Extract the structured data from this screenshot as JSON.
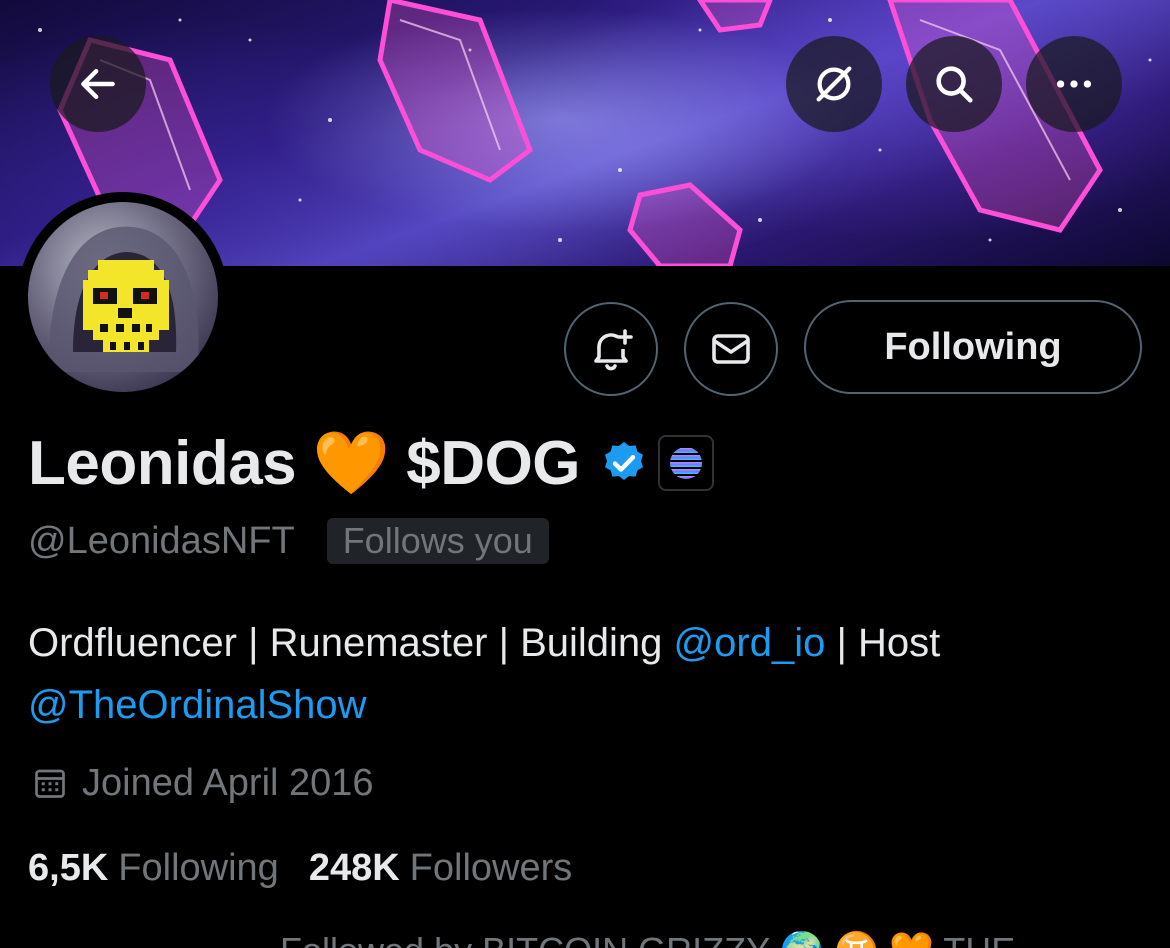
{
  "header": {
    "back_icon": "arrow-left-icon",
    "grok_icon": "grok-icon",
    "search_icon": "search-icon",
    "more_icon": "more-horizontal-icon"
  },
  "actions": {
    "notify_icon": "bell-plus-icon",
    "message_icon": "envelope-icon",
    "following_label": "Following"
  },
  "profile": {
    "display_name": "Leonidas 🧡 $DOG",
    "verified_icon": "verified-badge-icon",
    "affiliation_icon": "affiliation-badge-icon",
    "handle": "@LeonidasNFT",
    "follows_you": "Follows you",
    "bio": {
      "part1": "Ordfluencer | Runemaster | Building ",
      "mention1": "@ord_io",
      "part2": " | Host ",
      "mention2": "@TheOrdinalShow"
    },
    "joined": "Joined April 2016",
    "stats": {
      "following_count": "6,5K",
      "following_label": "Following",
      "followers_count": "248K",
      "followers_label": "Followers"
    },
    "followed_by_partial": "Followed by BITCOIN GRIZZY 🌍 ♊ 🧡 THE"
  },
  "colors": {
    "accent": "#1d9bf0",
    "background": "#000000",
    "muted_text": "#71767b",
    "border": "#536471"
  }
}
